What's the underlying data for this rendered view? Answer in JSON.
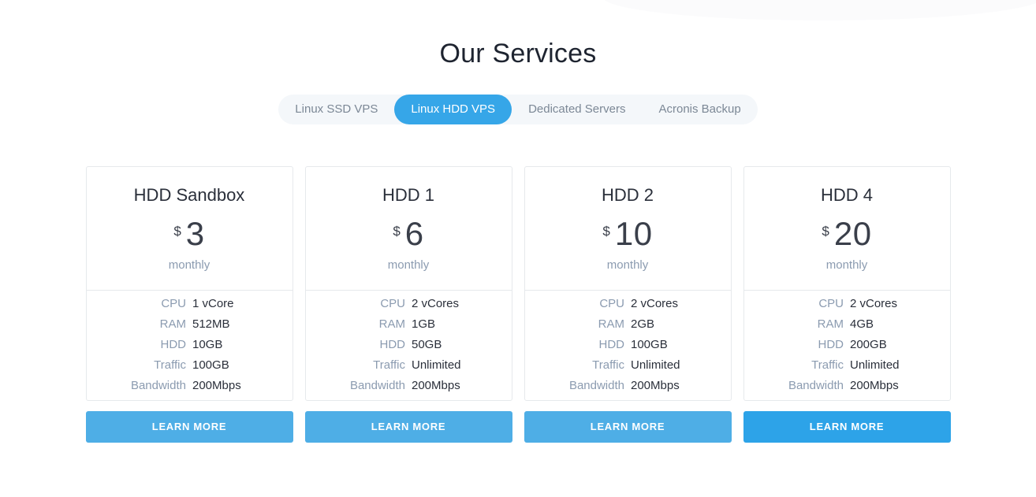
{
  "section": {
    "title": "Our Services"
  },
  "tabs": {
    "items": [
      {
        "label": "Linux SSD VPS",
        "active": false
      },
      {
        "label": "Linux HDD VPS",
        "active": true
      },
      {
        "label": "Dedicated Servers",
        "active": false
      },
      {
        "label": "Acronis Backup",
        "active": false
      }
    ],
    "active_color": "#36a6e8",
    "bar_background": "#f4f7fa",
    "inactive_text_color": "#7c8896"
  },
  "plans": [
    {
      "name": "HDD Sandbox",
      "currency": "$",
      "price": "3",
      "period": "monthly",
      "specs": [
        {
          "label": "CPU",
          "value": "1 vCore"
        },
        {
          "label": "RAM",
          "value": "512MB"
        },
        {
          "label": "HDD",
          "value": "10GB"
        },
        {
          "label": "Traffic",
          "value": "100GB"
        },
        {
          "label": "Bandwidth",
          "value": "200Mbps"
        }
      ],
      "cta_label": "LEARN MORE",
      "cta_hovered": false
    },
    {
      "name": "HDD 1",
      "currency": "$",
      "price": "6",
      "period": "monthly",
      "specs": [
        {
          "label": "CPU",
          "value": "2 vCores"
        },
        {
          "label": "RAM",
          "value": "1GB"
        },
        {
          "label": "HDD",
          "value": "50GB"
        },
        {
          "label": "Traffic",
          "value": "Unlimited"
        },
        {
          "label": "Bandwidth",
          "value": "200Mbps"
        }
      ],
      "cta_label": "LEARN MORE",
      "cta_hovered": false
    },
    {
      "name": "HDD 2",
      "currency": "$",
      "price": "10",
      "period": "monthly",
      "specs": [
        {
          "label": "CPU",
          "value": "2 vCores"
        },
        {
          "label": "RAM",
          "value": "2GB"
        },
        {
          "label": "HDD",
          "value": "100GB"
        },
        {
          "label": "Traffic",
          "value": "Unlimited"
        },
        {
          "label": "Bandwidth",
          "value": "200Mbps"
        }
      ],
      "cta_label": "LEARN MORE",
      "cta_hovered": false
    },
    {
      "name": "HDD 4",
      "currency": "$",
      "price": "20",
      "period": "monthly",
      "specs": [
        {
          "label": "CPU",
          "value": "2 vCores"
        },
        {
          "label": "RAM",
          "value": "4GB"
        },
        {
          "label": "HDD",
          "value": "200GB"
        },
        {
          "label": "Traffic",
          "value": "Unlimited"
        },
        {
          "label": "Bandwidth",
          "value": "200Mbps"
        }
      ],
      "cta_label": "LEARN MORE",
      "cta_hovered": true
    }
  ],
  "colors": {
    "button": "#4eaee6",
    "button_hover": "#2da3e8",
    "card_border": "#e6e9ec",
    "muted_text": "#8b9bb0",
    "dark_text": "#2a2f3a"
  }
}
